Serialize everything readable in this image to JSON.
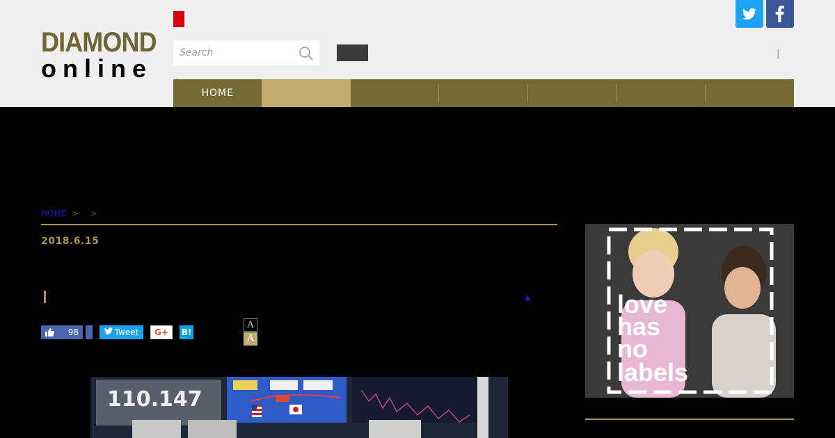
{
  "header": {
    "logo_top": "DIAMOND",
    "logo_bottom": "online",
    "search_placeholder": "Search",
    "pipe": "|",
    "brand_red": "#d7000f"
  },
  "nav": {
    "items": [
      {
        "label": "HOME",
        "active": false
      },
      {
        "label": "",
        "active": true
      },
      {
        "label": "",
        "active": false
      },
      {
        "label": "",
        "active": false
      },
      {
        "label": "",
        "active": false
      },
      {
        "label": "",
        "active": false
      },
      {
        "label": "",
        "active": false
      }
    ],
    "bg_color": "#766a34",
    "active_color": "#c2ad71"
  },
  "breadcrumb": {
    "home": "HOME",
    "sep": ">"
  },
  "article": {
    "date": "2018.6.15",
    "up_arrow": "▲"
  },
  "share": {
    "like_count": "98",
    "tweet_label": "Tweet",
    "gplus_label": "G+",
    "hatena_label": "B!"
  },
  "font_size": {
    "small": "A",
    "large": "A"
  },
  "photo": {
    "ticker": "110.147"
  },
  "ad": {
    "line1": "love",
    "line2": "has",
    "line3": "no",
    "line4": "labels"
  }
}
